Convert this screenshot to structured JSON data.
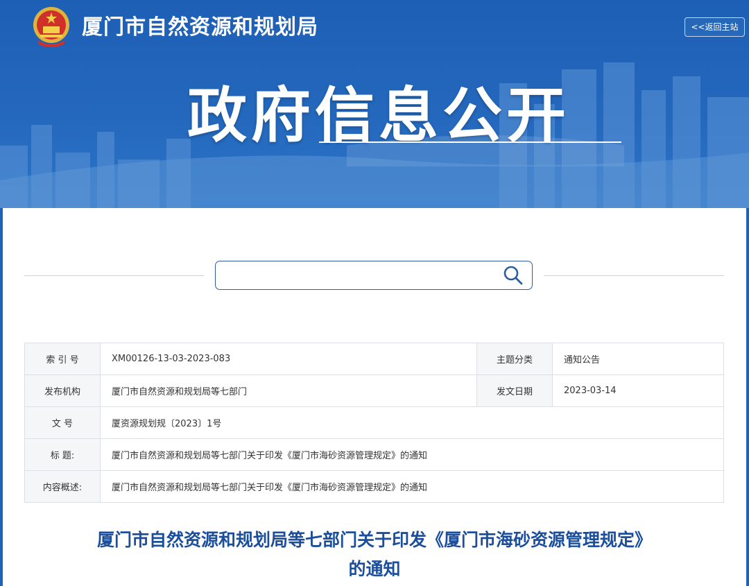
{
  "header": {
    "site_title": "厦门市自然资源和规划局",
    "back_label": "<<返回主站",
    "hero_title": "政府信息公开"
  },
  "search": {
    "value": "",
    "placeholder": ""
  },
  "meta": {
    "rows": [
      {
        "l1": "索 引 号",
        "v1": "XM00126-13-03-2023-083",
        "l2": "主题分类",
        "v2": "通知公告"
      },
      {
        "l1": "发布机构",
        "v1": "厦门市自然资源和规划局等七部门",
        "l2": "发文日期",
        "v2": "2023-03-14"
      },
      {
        "l1": "文    号",
        "v1": "厦资源规划规〔2023〕1号"
      },
      {
        "l1": "标    题:",
        "v1": "厦门市自然资源和规划局等七部门关于印发《厦门市海砂资源管理规定》的通知"
      },
      {
        "l1": "内容概述:",
        "v1": "厦门市自然资源和规划局等七部门关于印发《厦门市海砂资源管理规定》的通知"
      }
    ]
  },
  "document": {
    "title_line1": "厦门市自然资源和规划局等七部门关于印发《厦门市海砂资源管理规定》",
    "title_line2": "的通知"
  },
  "colors": {
    "banner": "#1f63b8",
    "title": "#1b4f9c",
    "border": "#dcdfe4"
  }
}
